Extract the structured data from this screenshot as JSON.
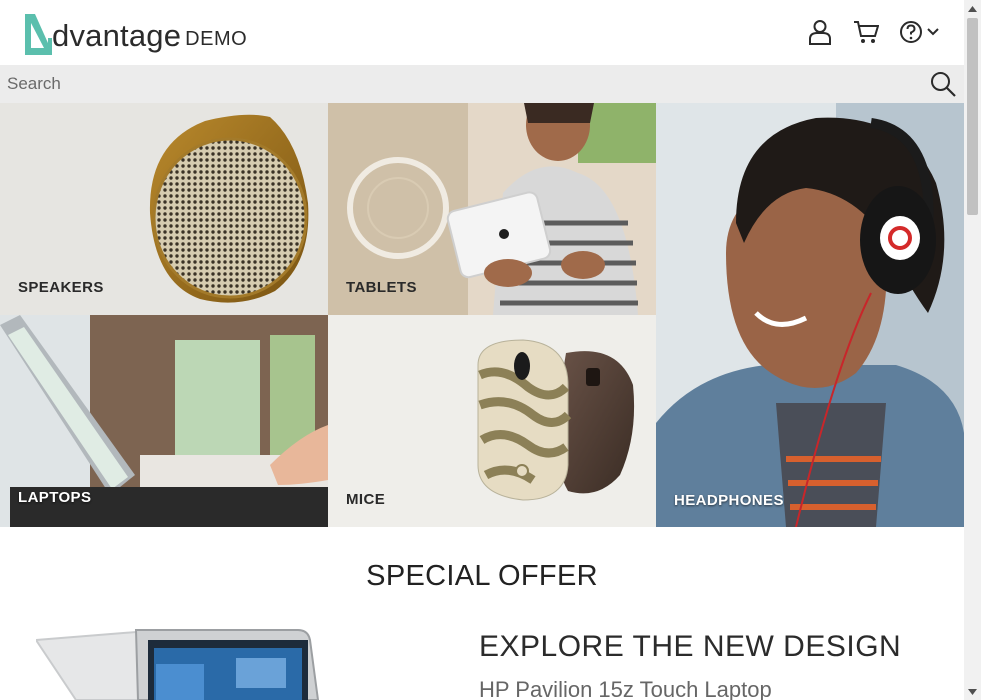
{
  "header": {
    "logo_word": "dvantage",
    "logo_sub": "DEMO",
    "user_icon": "user-icon",
    "cart_icon": "cart-icon",
    "help_icon": "help-icon"
  },
  "search": {
    "placeholder": "Search"
  },
  "categories": [
    {
      "label": "SPEAKERS"
    },
    {
      "label": "TABLETS"
    },
    {
      "label": "HEADPHONES"
    },
    {
      "label": "LAPTOPS"
    },
    {
      "label": "MICE"
    }
  ],
  "special_offer": {
    "title": "SPECIAL OFFER",
    "headline": "EXPLORE THE NEW DESIGN",
    "product": "HP Pavilion 15z Touch Laptop"
  },
  "colors": {
    "brand_teal": "#5bbfad",
    "header_bg": "#ffffff",
    "search_bg": "#ececec"
  }
}
